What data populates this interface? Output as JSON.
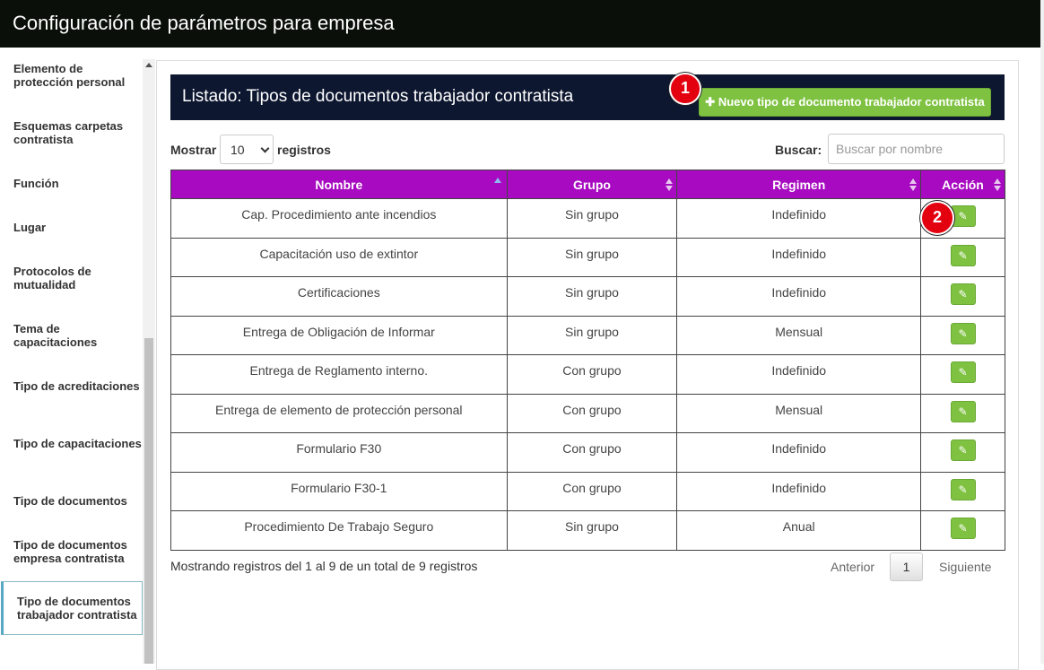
{
  "window": {
    "title": "Configuración de parámetros para empresa"
  },
  "sidebar": {
    "items": [
      {
        "label": "Elemento de protección personal"
      },
      {
        "label": "Esquemas carpetas contratista"
      },
      {
        "label": "Función"
      },
      {
        "label": "Lugar"
      },
      {
        "label": "Protocolos de mutualidad"
      },
      {
        "label": "Tema de capacitaciones"
      },
      {
        "label": "Tipo de acreditaciones"
      },
      {
        "label": "Tipo de capacitaciones"
      },
      {
        "label": "Tipo de documentos"
      },
      {
        "label": "Tipo de documentos empresa contratista"
      },
      {
        "label": "Tipo de documentos trabajador contratista"
      }
    ]
  },
  "panel": {
    "title": "Listado: Tipos de documentos trabajador contratista",
    "new_button_label": "Nuevo tipo de documento trabajador contratista"
  },
  "markers": {
    "first": "1",
    "second": "2"
  },
  "controls": {
    "show_label": "Mostrar",
    "page_size": "10",
    "records_label": "registros",
    "search_label": "Buscar:",
    "search_placeholder": "Buscar por nombre"
  },
  "table": {
    "columns": [
      "Nombre",
      "Grupo",
      "Regimen",
      "Acción"
    ],
    "rows": [
      {
        "nombre": "Cap. Procedimiento ante incendios",
        "grupo": "Sin grupo",
        "regimen": "Indefinido"
      },
      {
        "nombre": "Capacitación uso de extintor",
        "grupo": "Sin grupo",
        "regimen": "Indefinido"
      },
      {
        "nombre": "Certificaciones",
        "grupo": "Sin grupo",
        "regimen": "Indefinido"
      },
      {
        "nombre": "Entrega de Obligación de Informar",
        "grupo": "Sin grupo",
        "regimen": "Mensual"
      },
      {
        "nombre": "Entrega de Reglamento interno.",
        "grupo": "Con grupo",
        "regimen": "Indefinido"
      },
      {
        "nombre": "Entrega de elemento de protección personal",
        "grupo": "Con grupo",
        "regimen": "Mensual"
      },
      {
        "nombre": "Formulario F30",
        "grupo": "Con grupo",
        "regimen": "Indefinido"
      },
      {
        "nombre": "Formulario F30-1",
        "grupo": "Con grupo",
        "regimen": "Indefinido"
      },
      {
        "nombre": "Procedimiento De Trabajo Seguro",
        "grupo": "Sin grupo",
        "regimen": "Anual"
      }
    ]
  },
  "footer": {
    "info": "Mostrando registros del 1 al 9 de un total de 9 registros",
    "prev": "Anterior",
    "page": "1",
    "next": "Siguiente"
  },
  "colors": {
    "header_bg": "#0a0f0a",
    "panel_head": "#0e1730",
    "table_head": "#a70ac0",
    "action_green": "#7fc241",
    "marker_red": "#e3000f"
  }
}
